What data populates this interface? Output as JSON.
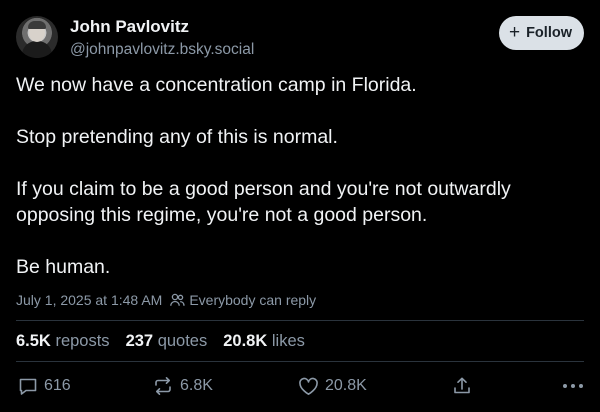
{
  "author": {
    "display_name": "John Pavlovitz",
    "handle": "@johnpavlovitz.bsky.social"
  },
  "follow_button": {
    "label": "Follow",
    "icon": "plus-icon"
  },
  "post": {
    "paragraphs": [
      "We now have a concentration camp in Florida.",
      "Stop pretending any of this is normal.",
      "If you claim to be a good person and you're not outwardly opposing this regime, you're not a good person.",
      "Be human."
    ],
    "timestamp": "July 1, 2025 at 1:48 AM",
    "reply_setting": "Everybody can reply"
  },
  "stats": {
    "reposts": {
      "count": "6.5K",
      "label": "reposts"
    },
    "quotes": {
      "count": "237",
      "label": "quotes"
    },
    "likes": {
      "count": "20.8K",
      "label": "likes"
    }
  },
  "actions": {
    "reply_count": "616",
    "repost_count": "6.8K",
    "like_count": "20.8K"
  },
  "colors": {
    "background": "#000000",
    "text": "#f1f3f5",
    "muted": "#8c99a7",
    "follow_button_bg": "#dbe1e7",
    "divider": "#2a333c"
  }
}
